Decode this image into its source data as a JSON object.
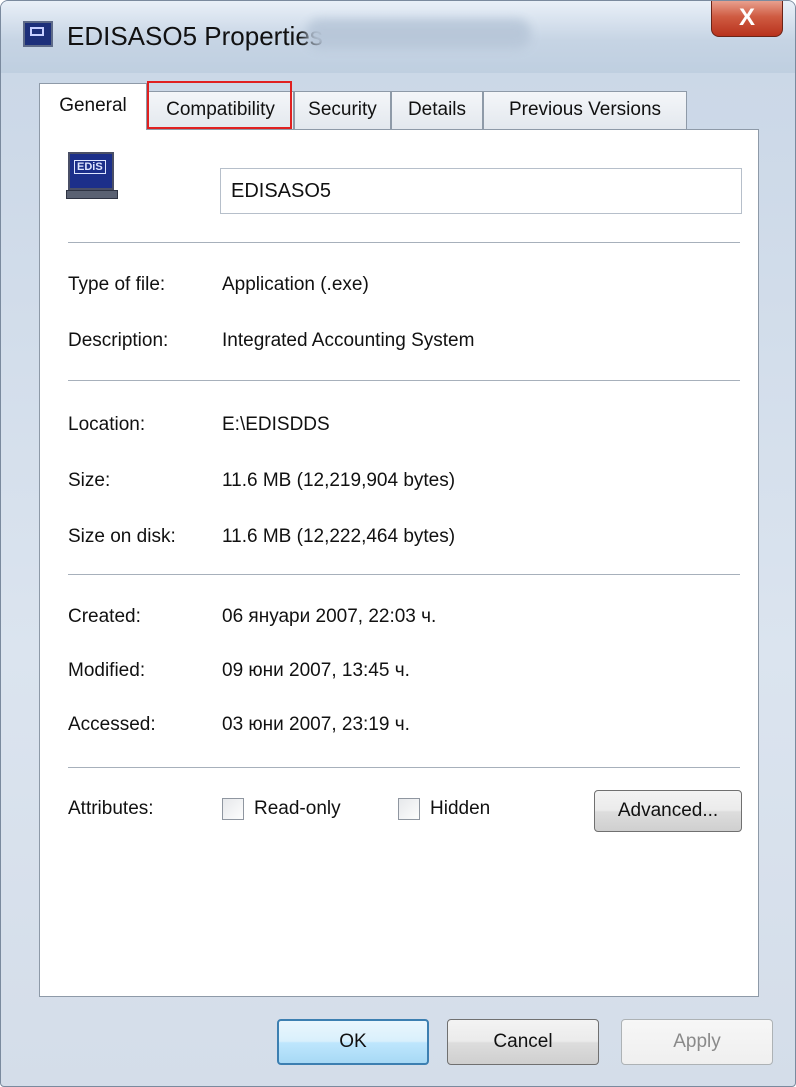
{
  "window": {
    "title": "EDISASO5 Properties",
    "close_glyph": "X"
  },
  "tabs": [
    {
      "label": "General",
      "active": true
    },
    {
      "label": "Compatibility",
      "active": false,
      "highlighted": true
    },
    {
      "label": "Security",
      "active": false
    },
    {
      "label": "Details",
      "active": false
    },
    {
      "label": "Previous Versions",
      "active": false
    }
  ],
  "general": {
    "app_icon_text": "EDiS",
    "file_name": "EDISASO5",
    "type": {
      "label": "Type of file:",
      "value": "Application (.exe)"
    },
    "description": {
      "label": "Description:",
      "value": "Integrated Accounting System"
    },
    "location": {
      "label": "Location:",
      "value": "E:\\EDISDDS"
    },
    "size": {
      "label": "Size:",
      "value": "11.6 MB (12,219,904 bytes)"
    },
    "size_on_disk": {
      "label": "Size on disk:",
      "value": "11.6 MB (12,222,464 bytes)"
    },
    "created": {
      "label": "Created:",
      "value": "06 януари 2007, 22:03 ч."
    },
    "modified": {
      "label": "Modified:",
      "value": "09 юни 2007, 13:45 ч."
    },
    "accessed": {
      "label": "Accessed:",
      "value": "03 юни 2007, 23:19 ч."
    },
    "attributes": {
      "label": "Attributes:",
      "read_only": {
        "label": "Read-only",
        "checked": false
      },
      "hidden": {
        "label": "Hidden",
        "checked": false
      },
      "advanced_label": "Advanced..."
    }
  },
  "footer": {
    "ok_label": "OK",
    "cancel_label": "Cancel",
    "apply_label": "Apply",
    "apply_enabled": false
  },
  "icons": {
    "window_icon": "application-icon",
    "file_icon": "computer-monitor-icon",
    "close": "close-icon"
  },
  "colors": {
    "highlight_border": "#e02020",
    "close_button": "#c8452d"
  }
}
